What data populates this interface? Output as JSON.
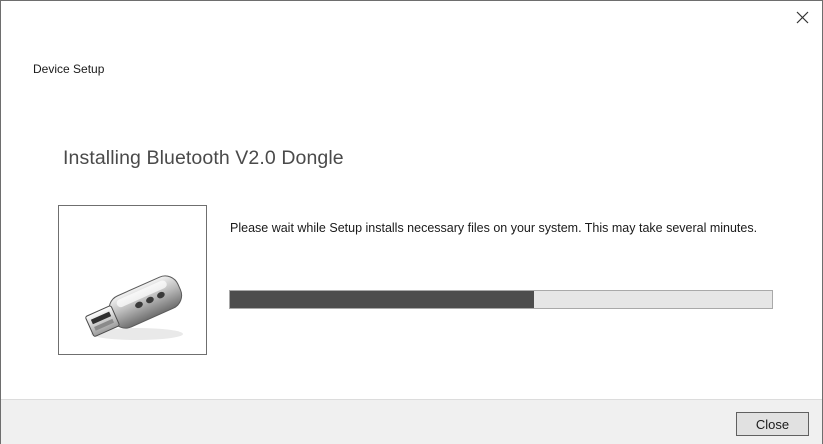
{
  "window": {
    "title": "Device Setup",
    "close_icon": "close-icon"
  },
  "main": {
    "heading": "Installing Bluetooth V2.0 Dongle",
    "message": "Please wait while Setup installs necessary files on your system. This may take several minutes.",
    "device_icon": "usb-dongle-icon",
    "progress_percent": 56
  },
  "footer": {
    "close_label": "Close"
  },
  "colors": {
    "progress_fill": "#4d4d4d",
    "progress_track": "#e6e6e6",
    "footer_bg": "#f0f0f0"
  }
}
